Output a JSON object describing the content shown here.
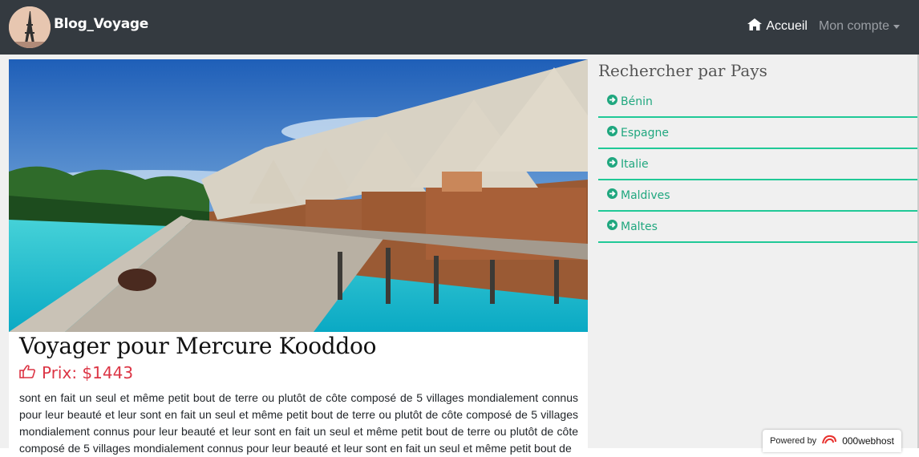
{
  "navbar": {
    "brand": "Blog_Voyage",
    "home_label": "Accueil",
    "account_label": "Mon compte"
  },
  "post": {
    "title": "Voyager pour Mercure Kooddoo",
    "price": "Prix: $1443",
    "description": "sont en fait un seul et même petit bout de terre ou plutôt de côte composé de 5 villages mondialement connus pour leur beauté et leur sont en fait un seul et même petit bout de terre ou plutôt de côte composé de 5 villages mondialement connus pour leur beauté et leur sont en fait un seul et même petit bout de terre ou plutôt de côte composé de 5 villages mondialement connus pour leur beauté et leur sont en fait un seul et même petit bout de"
  },
  "sidebar": {
    "title": "Rechercher par Pays",
    "countries": [
      {
        "label": "Bénin"
      },
      {
        "label": "Espagne"
      },
      {
        "label": "Italie"
      },
      {
        "label": "Maldives"
      },
      {
        "label": "Maltes"
      }
    ]
  },
  "footer_badge": {
    "powered_by": "Powered by",
    "host": "000webhost"
  },
  "colors": {
    "navbar": "#343a40",
    "accent_green": "#20c997",
    "price_red": "#dc3545"
  },
  "icons": {
    "home": "home-icon",
    "country": "arrow-circle-right-icon",
    "price": "thumbs-up-icon"
  }
}
